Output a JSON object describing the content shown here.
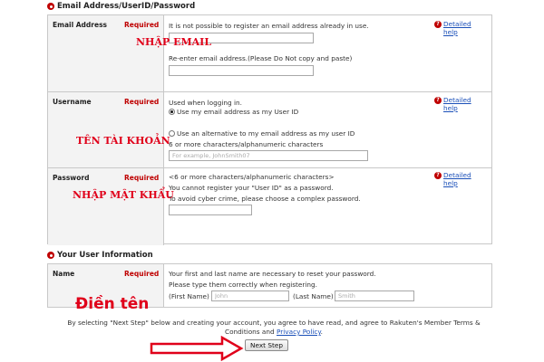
{
  "sections": {
    "account": {
      "title": "Email Address/UserID/Password"
    },
    "info": {
      "title": "Your User Information"
    }
  },
  "required_label": "Required",
  "help": {
    "label": "Detailed help",
    "icon": "question-icon"
  },
  "email": {
    "label": "Email Address",
    "note": "It is not possible to register an email address already in use.",
    "reenter_note": "Re-enter email address.(Please Do Not copy and paste)",
    "value": "",
    "reenter_value": ""
  },
  "username": {
    "label": "Username",
    "used_when": "Used when logging in.",
    "option_email": "Use my email address as my User ID",
    "option_alt": "Use an alternative to my email address as my user ID",
    "rule": "6 or more characters/alphanumeric characters",
    "placeholder": "For example, JohnSmith07",
    "selected_option": "option_email"
  },
  "password": {
    "label": "Password",
    "rule": "<6 or more characters/alphanumeric characters>",
    "warning1": "You cannot register your \"User ID\" as a password.",
    "warning2": "To avoid cyber crime, please choose a complex password.",
    "value": ""
  },
  "name": {
    "label": "Name",
    "note1": "Your first and last name are necessary to reset your password.",
    "note2": "Please type them correctly when registering.",
    "first_label": "(First Name)",
    "first_placeholder": "John",
    "last_label": "(Last Name)",
    "last_placeholder": "Smith"
  },
  "agreement": {
    "line1": "By selecting \"Next Step\" below and creating your account, you agree to have read, and agree to Rakuten's Member Terms &",
    "line2_pre": "Conditions and",
    "privacy_link": "Privacy Policy",
    "line2_post": "."
  },
  "next_button": "Next Step",
  "annotations": {
    "email": "NHẬP EMAIL",
    "username": "TÊN TÀI KHOẢN",
    "password": "NHẬP MẬT KHẨU",
    "name": "Điền tên"
  },
  "colors": {
    "accent": "#bf0000",
    "annotation": "#e0001a",
    "link": "#1a4fb8"
  }
}
